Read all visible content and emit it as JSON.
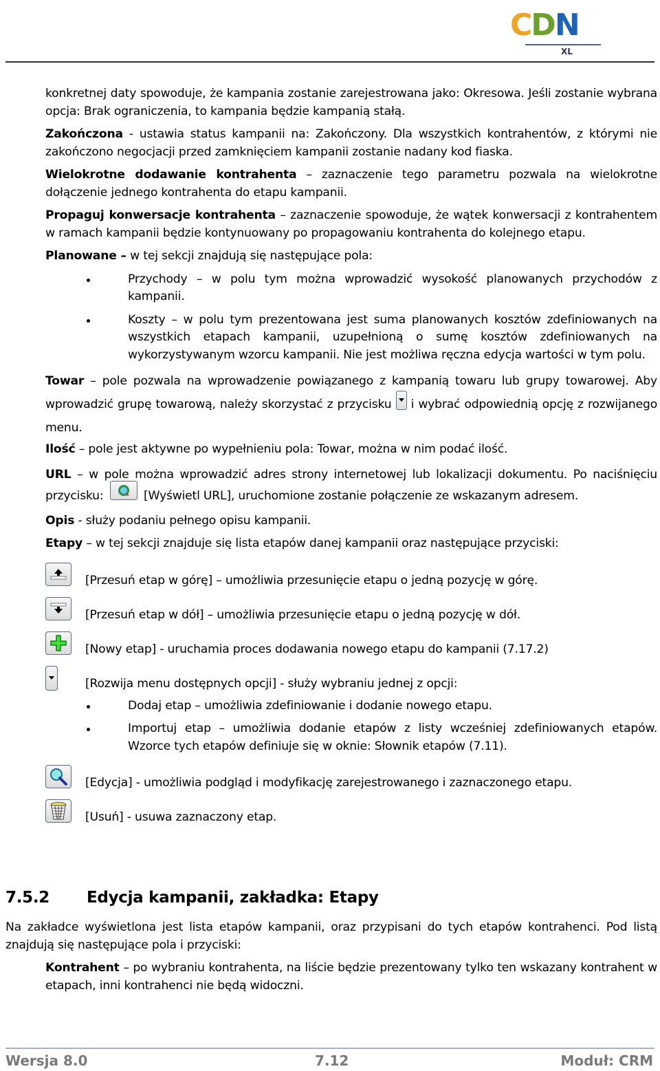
{
  "logo": {
    "c": "C",
    "d": "D",
    "n": "N",
    "sub": "XL"
  },
  "intro": {
    "p1": "konkretnej daty spowoduje, że kampania zostanie zarejestrowana jako: Okresowa. Jeśli zostanie wybrana opcja: Brak ograniczenia, to kampania będzie kampanią stałą."
  },
  "fields": {
    "zakonczona": {
      "term": "Zakończona",
      "text": " - ustawia status kampanii na: Zakończony. Dla wszystkich kontrahentów, z którymi nie zakończono negocjacji przed zamknięciem kampanii zostanie nadany kod fiaska."
    },
    "wielokrotne": {
      "term": "Wielokrotne dodawanie kontrahenta",
      "text": " – zaznaczenie tego parametru pozwala na wielokrotne dołączenie jednego kontrahenta do etapu kampanii."
    },
    "propaguj": {
      "term": "Propaguj konwersacje kontrahenta",
      "text": " – zaznaczenie spowoduje, że wątek konwersacji z kontrahentem w ramach kampanii będzie kontynuowany po propagowaniu kontrahenta do kolejnego etapu."
    },
    "planowane": {
      "term": "Planowane –",
      "text": " w tej sekcji znajdują się następujące pola:",
      "items": [
        "Przychody – w polu tym można wprowadzić wysokość planowanych przychodów z kampanii.",
        "Koszty – w polu tym prezentowana jest suma planowanych kosztów zdefiniowanych na wszystkich etapach kampanii, uzupełnioną o sumę kosztów zdefiniowanych na wykorzystywanym wzorcu kampanii. Nie jest możliwa ręczna edycja wartości w tym polu."
      ]
    },
    "towar": {
      "term": "Towar",
      "text1": " – pole pozwala na wprowadzenie powiązanego z kampanią towaru lub grupy towarowej. Aby wprowadzić grupę towarową, należy skorzystać z przycisku ",
      "text2": " i wybrać odpowiednią opcję z rozwijanego menu."
    },
    "ilosc": {
      "term": "Ilość",
      "text": " – pole jest aktywne po wypełnieniu pola: Towar, można w nim podać ilość."
    },
    "url": {
      "term": "URL",
      "text1": " – w pole można wprowadzić adres strony internetowej lub lokalizacji dokumentu. Po naciśnięciu przycisku: ",
      "text2": " [Wyświetl URL], uruchomione zostanie połączenie ze wskazanym adresem."
    },
    "opis": {
      "term": "Opis",
      "text": " - służy podaniu pełnego opisu kampanii."
    },
    "etapy": {
      "term": "Etapy",
      "text": " – w tej sekcji znajduje się lista etapów danej kampanii oraz następujące przyciski:"
    }
  },
  "buttons": [
    {
      "icon": "move-up-icon",
      "label": "[Przesuń etap w górę] – umożliwia przesunięcie etapu o jedną pozycję w górę."
    },
    {
      "icon": "move-down-icon",
      "label": "[Przesuń etap w dół] – umożliwia przesunięcie etapu o jedną pozycję w dół."
    },
    {
      "icon": "add-icon",
      "label": "[Nowy etap] - uruchamia proces dodawania nowego etapu do kampanii (7.17.2)"
    },
    {
      "icon": "dropdown-icon",
      "label": "[Rozwija menu dostępnych opcji] - służy wybraniu jednej z opcji:",
      "options": [
        "Dodaj etap – umożliwia zdefiniowanie i dodanie nowego etapu.",
        "Importuj etap – umożliwia dodanie etapów z listy wcześniej zdefiniowanych etapów. Wzorce tych etapów definiuje się w oknie: Słownik etapów (7.11)."
      ]
    },
    {
      "icon": "edit-magnifier-icon",
      "label": "[Edycja] - umożliwia podgląd i modyfikację zarejestrowanego i zaznaczonego etapu."
    },
    {
      "icon": "trash-icon",
      "label": "[Usuń] - usuwa zaznaczony etap."
    }
  ],
  "section": {
    "number": "7.5.2",
    "title": "Edycja kampanii, zakładka: Etapy",
    "intro": "Na zakładce wyświetlona jest lista etapów kampanii, oraz przypisani do tych etapów kontrahenci. Pod listą znajdują się następujące pola i przyciski:",
    "kontrahent": {
      "term": "Kontrahent",
      "text": " – po wybraniu kontrahenta, na liście będzie prezentowany tylko ten wskazany kontrahent w etapach, inni kontrahenci nie będą widoczni."
    }
  },
  "footer": {
    "version": "Wersja 8.0",
    "page": "7.12",
    "module": "Moduł: CRM"
  }
}
